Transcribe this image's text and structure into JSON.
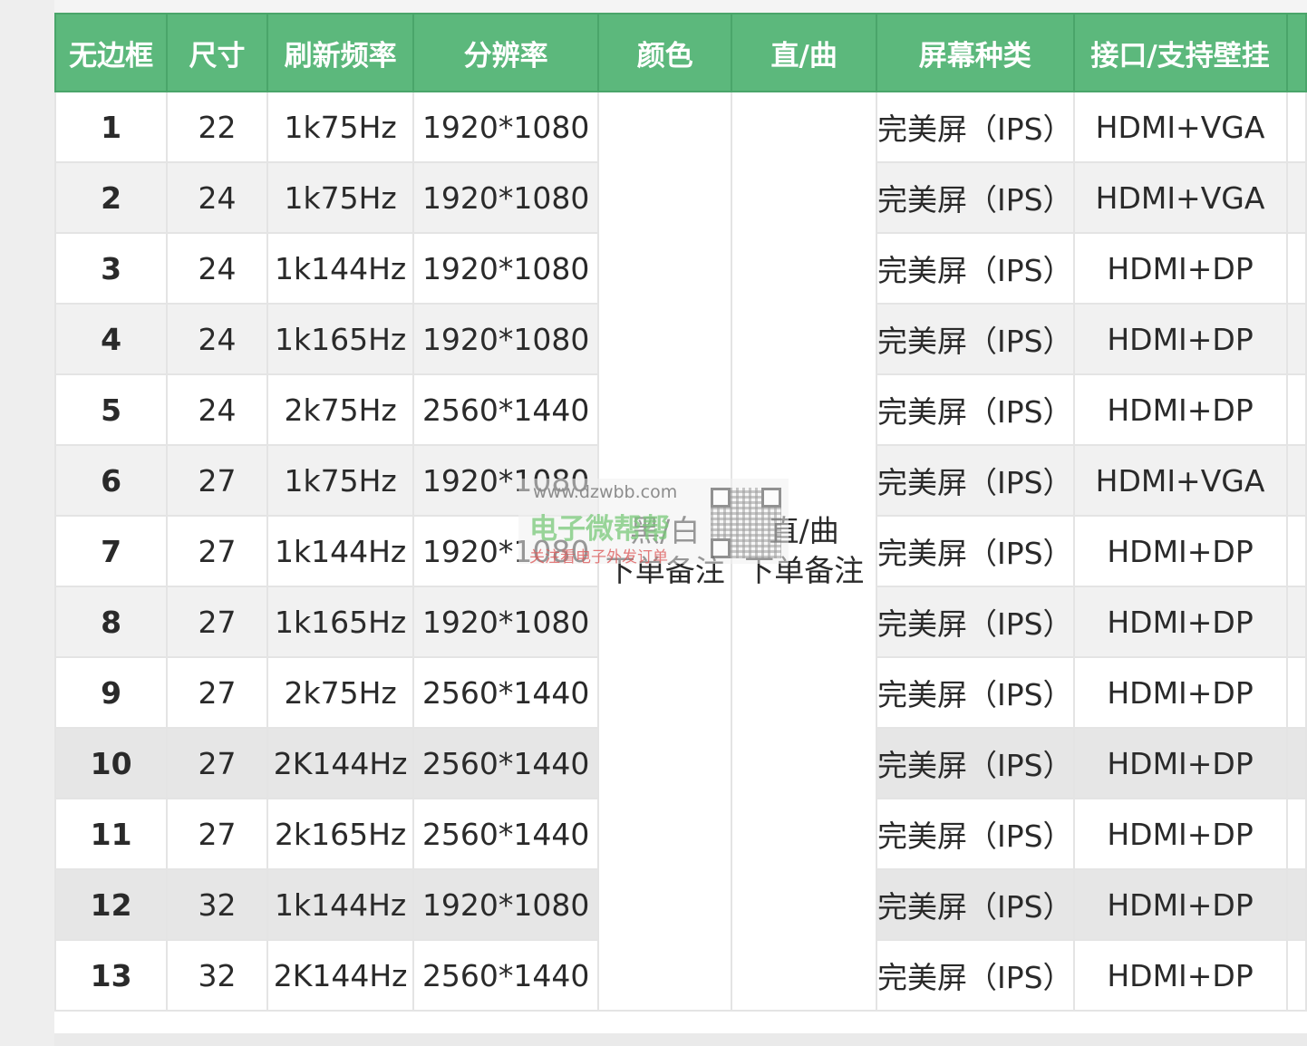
{
  "table": {
    "headers": [
      "无边框",
      "尺寸",
      "刷新频率",
      "分辨率",
      "颜色",
      "直/曲",
      "屏幕种类",
      "接口/支持壁挂"
    ],
    "color_note": [
      "黑/白",
      "下单备注"
    ],
    "shape_note": [
      "直/曲",
      "下单备注"
    ],
    "rows": [
      {
        "no": "1",
        "size": "22",
        "refresh": "1k75Hz",
        "resolution": "1920*1080",
        "screen": "完美屏（IPS）",
        "port": "HDMI+VGA"
      },
      {
        "no": "2",
        "size": "24",
        "refresh": "1k75Hz",
        "resolution": "1920*1080",
        "screen": "完美屏（IPS）",
        "port": "HDMI+VGA"
      },
      {
        "no": "3",
        "size": "24",
        "refresh": "1k144Hz",
        "resolution": "1920*1080",
        "screen": "完美屏（IPS）",
        "port": "HDMI+DP"
      },
      {
        "no": "4",
        "size": "24",
        "refresh": "1k165Hz",
        "resolution": "1920*1080",
        "screen": "完美屏（IPS）",
        "port": "HDMI+DP"
      },
      {
        "no": "5",
        "size": "24",
        "refresh": "2k75Hz",
        "resolution": "2560*1440",
        "screen": "完美屏（IPS）",
        "port": "HDMI+DP"
      },
      {
        "no": "6",
        "size": "27",
        "refresh": "1k75Hz",
        "resolution": "1920*1080",
        "screen": "完美屏（IPS）",
        "port": "HDMI+VGA"
      },
      {
        "no": "7",
        "size": "27",
        "refresh": "1k144Hz",
        "resolution": "1920*1080",
        "screen": "完美屏（IPS）",
        "port": "HDMI+DP"
      },
      {
        "no": "8",
        "size": "27",
        "refresh": "1k165Hz",
        "resolution": "1920*1080",
        "screen": "完美屏（IPS）",
        "port": "HDMI+DP"
      },
      {
        "no": "9",
        "size": "27",
        "refresh": "2k75Hz",
        "resolution": "2560*1440",
        "screen": "完美屏（IPS）",
        "port": "HDMI+DP"
      },
      {
        "no": "10",
        "size": "27",
        "refresh": "2K144Hz",
        "resolution": "2560*1440",
        "screen": "完美屏（IPS）",
        "port": "HDMI+DP"
      },
      {
        "no": "11",
        "size": "27",
        "refresh": "2k165Hz",
        "resolution": "2560*1440",
        "screen": "完美屏（IPS）",
        "port": "HDMI+DP"
      },
      {
        "no": "12",
        "size": "32",
        "refresh": "1k144Hz",
        "resolution": "1920*1080",
        "screen": "完美屏（IPS）",
        "port": "HDMI+DP"
      },
      {
        "no": "13",
        "size": "32",
        "refresh": "2K144Hz",
        "resolution": "2560*1440",
        "screen": "完美屏（IPS）",
        "port": "HDMI+DP"
      }
    ]
  },
  "watermark": {
    "url": "www.dzwbb.com",
    "title": "电子微帮帮",
    "subtitle": "关注看电子外发订单"
  },
  "colors": {
    "header_bg": "#5cb87c",
    "header_text": "#ffffff",
    "row_shade": "#f1f1f1"
  }
}
